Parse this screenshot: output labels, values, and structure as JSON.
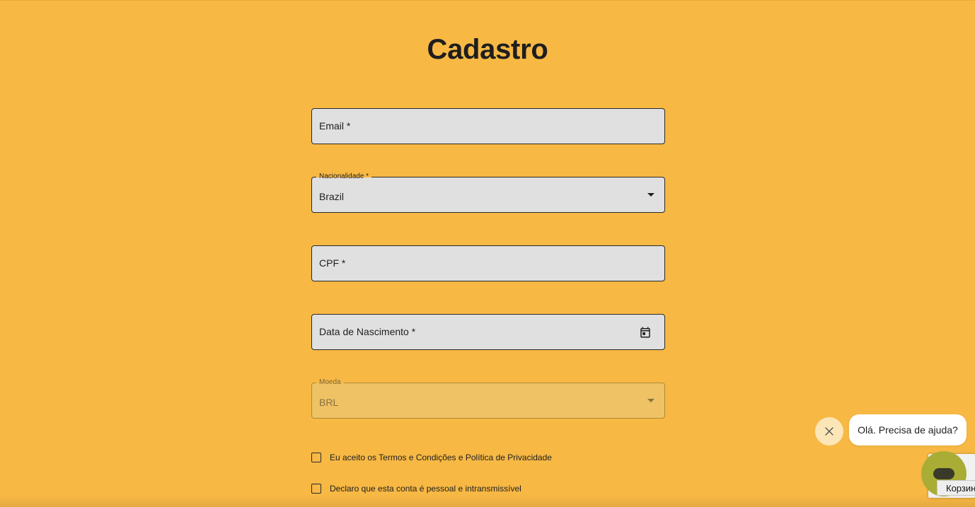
{
  "page": {
    "title": "Cadastro",
    "background_color": "#F7B844"
  },
  "form": {
    "email": {
      "label": "Email *"
    },
    "nationality": {
      "label": "Nacionalidade *",
      "value": "Brazil"
    },
    "cpf": {
      "label": "CPF *"
    },
    "birth_date": {
      "label": "Data de Nascimento *",
      "icon": "calendar-icon"
    },
    "currency": {
      "label": "Moeda",
      "value": "BRL",
      "disabled": true
    },
    "checkboxes": [
      {
        "label": "Eu aceito os Termos e Condições e Política de Privacidade",
        "checked": false
      },
      {
        "label": "Declaro que esta conta é pessoal e intransmissível",
        "checked": false
      }
    ]
  },
  "chat": {
    "greeting": "Olá. Precisa de ajuda?",
    "close_icon": "close-icon",
    "launcher_color": "#A9AD35"
  },
  "tooltip": {
    "text": "Корзина"
  }
}
